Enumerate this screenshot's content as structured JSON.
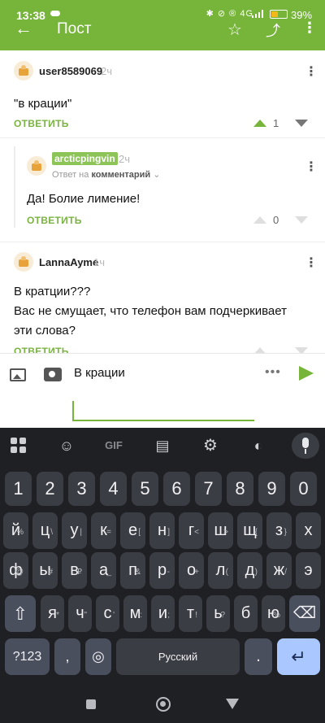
{
  "status_bar": {
    "time": "13:38",
    "icons_text": "✱ ⊘ ® 4G",
    "battery": "39%"
  },
  "header": {
    "title": "Пост"
  },
  "comments": [
    {
      "username": "user8589069",
      "time": "2ч",
      "text": "\"в крации\"",
      "reply_label": "ОТВЕТИТЬ",
      "score": "1"
    },
    {
      "username": "arcticpingvin",
      "time": "2ч",
      "reply_to_prefix": "Ответ на",
      "reply_to_target": "комментарий",
      "text": "Да! Болие лимение!",
      "reply_label": "ОТВЕТИТЬ",
      "score": "0"
    },
    {
      "username": "LannaAyme",
      "time": "1ч",
      "text_line1": "В кратции???",
      "text_line2": "Вас не смущает, что телефон вам подчеркивает",
      "text_line3": "эти слова?",
      "reply_label": "ОТВЕТИТЬ"
    }
  ],
  "composer": {
    "text": "В крации",
    "more": "•••"
  },
  "keyboard": {
    "gif_label": "GIF",
    "row_numbers": [
      {
        "k": "1"
      },
      {
        "k": "2"
      },
      {
        "k": "3"
      },
      {
        "k": "4"
      },
      {
        "k": "5"
      },
      {
        "k": "6"
      },
      {
        "k": "7"
      },
      {
        "k": "8"
      },
      {
        "k": "9"
      },
      {
        "k": "0"
      }
    ],
    "row1": [
      {
        "k": "й",
        "h": "%"
      },
      {
        "k": "ц",
        "h": "\\"
      },
      {
        "k": "у",
        "h": "|"
      },
      {
        "k": "к",
        "h": "="
      },
      {
        "k": "е",
        "h": "["
      },
      {
        "k": "н",
        "h": "]"
      },
      {
        "k": "г",
        "h": "<"
      },
      {
        "k": "ш",
        "h": ">"
      },
      {
        "k": "щ",
        "h": "{"
      },
      {
        "k": "з",
        "h": "}"
      },
      {
        "k": "х",
        "h": ""
      }
    ],
    "row2": [
      {
        "k": "ф",
        "h": "@"
      },
      {
        "k": "ы",
        "h": "#"
      },
      {
        "k": "в",
        "h": "₽"
      },
      {
        "k": "а",
        "h": "_"
      },
      {
        "k": "п",
        "h": "&"
      },
      {
        "k": "р",
        "h": "-"
      },
      {
        "k": "о",
        "h": "+"
      },
      {
        "k": "л",
        "h": "("
      },
      {
        "k": "д",
        "h": ")"
      },
      {
        "k": "ж",
        "h": "/"
      },
      {
        "k": "э",
        "h": ""
      }
    ],
    "row3": [
      {
        "k": "я",
        "h": "*"
      },
      {
        "k": "ч",
        "h": "\""
      },
      {
        "k": "с",
        "h": "'"
      },
      {
        "k": "м",
        "h": ":"
      },
      {
        "k": "и",
        "h": ";"
      },
      {
        "k": "т",
        "h": "!"
      },
      {
        "k": "ь",
        "h": "?"
      },
      {
        "k": "б",
        "h": ""
      },
      {
        "k": "ю",
        "h": "%"
      }
    ],
    "symbols_label": "?123",
    "comma": ",",
    "space_label": "Русский",
    "period": "."
  }
}
